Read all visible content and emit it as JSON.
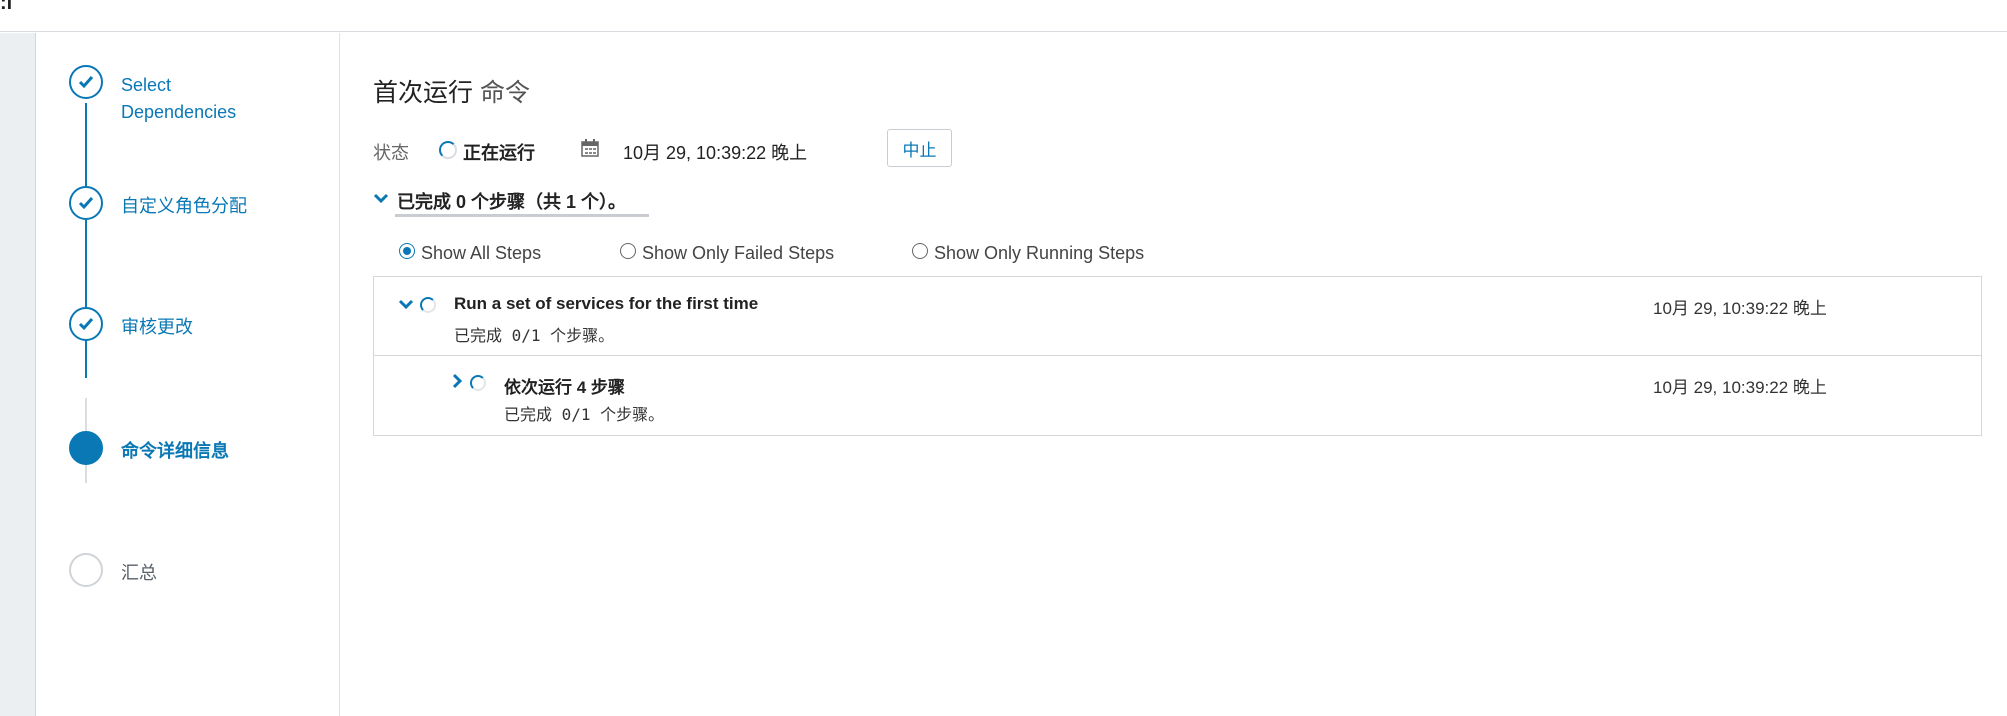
{
  "header": {
    "fragment": ":l"
  },
  "wizard": {
    "steps": [
      {
        "label_line1": "Select",
        "label_line2": "Dependencies",
        "state": "done"
      },
      {
        "label": "自定义角色分配",
        "state": "done"
      },
      {
        "label": "审核更改",
        "state": "done"
      },
      {
        "label": "命令详细信息",
        "state": "current"
      },
      {
        "label": "汇总",
        "state": "todo"
      }
    ]
  },
  "command": {
    "title_main": "首次运行",
    "title_suffix": " 命令",
    "status_label": "状态",
    "status_value": "正在运行",
    "start_time": "10月 29, 10:39:22 晚上",
    "abort_label": "中止",
    "summary": "已完成 0 个步骤（共 1 个）。"
  },
  "filters": {
    "options": [
      "Show All Steps",
      "Show Only Failed Steps",
      "Show Only Running Steps"
    ],
    "selected": "Show All Steps"
  },
  "steps": [
    {
      "title": "Run a set of services for the first time",
      "progress": "已完成 0/1 个步骤。",
      "time": "10月 29, 10:39:22 晚上",
      "expanded": true,
      "status": "running"
    },
    {
      "title": "依次运行 4 步骤",
      "progress": "已完成 0/1 个步骤。",
      "time": "10月 29, 10:39:22 晚上",
      "expanded": false,
      "status": "running"
    }
  ],
  "colors": {
    "accent": "#0a78b5",
    "border": "#d3d7dc",
    "gutter": "#eceff2"
  }
}
